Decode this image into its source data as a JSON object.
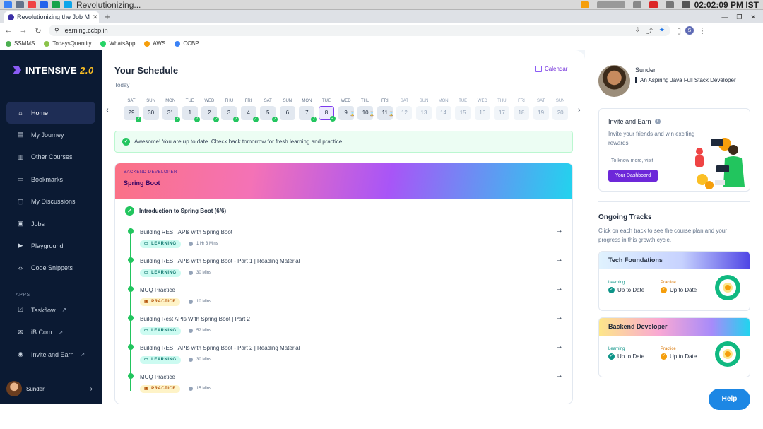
{
  "system": {
    "window_title": "Revolutionizing...",
    "time": "02:02:09 PM IST"
  },
  "browser": {
    "tab_title": "Revolutionizing the Job M",
    "new_tab": "+",
    "url": "learning.ccbp.in",
    "bookmarks": [
      {
        "label": "SSMMS",
        "color": "#4caf50"
      },
      {
        "label": "TodaysQuantity",
        "color": "#8bc34a"
      },
      {
        "label": "WhatsApp",
        "color": "#25d366"
      },
      {
        "label": "AWS",
        "color": "#f59e0b"
      },
      {
        "label": "CCBP",
        "color": "#3b82f6"
      }
    ]
  },
  "sidebar": {
    "logo": "INTENSIVE",
    "logo_version": "2.0",
    "items": [
      {
        "label": "Home",
        "icon": "home-icon",
        "active": true
      },
      {
        "label": "My Journey",
        "icon": "journey-icon"
      },
      {
        "label": "Other Courses",
        "icon": "courses-icon"
      },
      {
        "label": "Bookmarks",
        "icon": "bookmark-icon"
      },
      {
        "label": "My Discussions",
        "icon": "discussion-icon"
      },
      {
        "label": "Jobs",
        "icon": "jobs-icon"
      },
      {
        "label": "Playground",
        "icon": "playground-icon"
      },
      {
        "label": "Code Snippets",
        "icon": "code-icon"
      }
    ],
    "apps_label": "APPS",
    "apps": [
      {
        "label": "Taskflow",
        "icon": "taskflow-icon"
      },
      {
        "label": "iB Com",
        "icon": "ibcom-icon"
      },
      {
        "label": "Invite and Earn",
        "icon": "invite-icon"
      }
    ],
    "user_name": "Sunder"
  },
  "schedule": {
    "title": "Your Schedule",
    "subtitle": "Today",
    "calendar_link": "Calendar",
    "days": [
      {
        "name": "SAT",
        "num": "29",
        "state": "done"
      },
      {
        "name": "SUN",
        "num": "30",
        "state": "off"
      },
      {
        "name": "MON",
        "num": "31",
        "state": "done"
      },
      {
        "name": "TUE",
        "num": "1",
        "state": "done"
      },
      {
        "name": "WED",
        "num": "2",
        "state": "done"
      },
      {
        "name": "THU",
        "num": "3",
        "state": "done"
      },
      {
        "name": "FRI",
        "num": "4",
        "state": "done"
      },
      {
        "name": "SAT",
        "num": "5",
        "state": "done"
      },
      {
        "name": "SUN",
        "num": "6",
        "state": "off"
      },
      {
        "name": "MON",
        "num": "7",
        "state": "done"
      },
      {
        "name": "TUE",
        "num": "8",
        "state": "selected"
      },
      {
        "name": "WED",
        "num": "9",
        "state": "pending"
      },
      {
        "name": "THU",
        "num": "10",
        "state": "pending"
      },
      {
        "name": "FRI",
        "num": "11",
        "state": "pending"
      },
      {
        "name": "SAT",
        "num": "12",
        "state": "future"
      },
      {
        "name": "SUN",
        "num": "13",
        "state": "future"
      },
      {
        "name": "MON",
        "num": "14",
        "state": "future"
      },
      {
        "name": "TUE",
        "num": "15",
        "state": "future"
      },
      {
        "name": "WED",
        "num": "16",
        "state": "future"
      },
      {
        "name": "THU",
        "num": "17",
        "state": "future"
      },
      {
        "name": "FRI",
        "num": "18",
        "state": "future"
      },
      {
        "name": "SAT",
        "num": "19",
        "state": "future"
      },
      {
        "name": "SUN",
        "num": "20",
        "state": "future"
      }
    ],
    "alert": "Awesome! You are up to date. Check back tomorrow for fresh learning and practice"
  },
  "course": {
    "category": "BACKEND DEVELOPER",
    "title": "Spring Boot",
    "module_title": "Introduction to Spring Boot (6/6)",
    "lessons": [
      {
        "title": "Building REST APIs with Spring Boot",
        "tag": "LEARNING",
        "duration": "1 Hr 3 Mins"
      },
      {
        "title": "Building REST APIs with Spring Boot - Part 1 | Reading Material",
        "tag": "LEARNING",
        "duration": "30 Mins"
      },
      {
        "title": "MCQ Practice",
        "tag": "PRACTICE",
        "duration": "10 Mins"
      },
      {
        "title": "Building Rest APIs With Spring Boot | Part 2",
        "tag": "LEARNING",
        "duration": "52 Mins"
      },
      {
        "title": "Building REST APIs with Spring Boot - Part 2 | Reading Material",
        "tag": "LEARNING",
        "duration": "30 Mins"
      },
      {
        "title": "MCQ Practice",
        "tag": "PRACTICE",
        "duration": "15 Mins"
      }
    ]
  },
  "profile": {
    "name": "Sunder",
    "role": "An Aspiring Java Full Stack Developer"
  },
  "invite": {
    "title": "Invite and Earn",
    "description": "Invite your friends and win exciting rewards.",
    "know_more": "To know more, visit",
    "button": "Your Dashboard"
  },
  "tracks": {
    "title": "Ongoing Tracks",
    "description": "Click on each track to see the course plan and your progress in this growth cycle.",
    "items": [
      {
        "name": "Tech Foundations",
        "learning_label": "Learning",
        "learning_value": "Up to Date",
        "practice_label": "Practice",
        "practice_value": "Up to Date"
      },
      {
        "name": "Backend Developer",
        "learning_label": "Learning",
        "learning_value": "Up to Date",
        "practice_label": "Practice",
        "practice_value": "Up to Date"
      }
    ]
  },
  "help_button": "Help"
}
